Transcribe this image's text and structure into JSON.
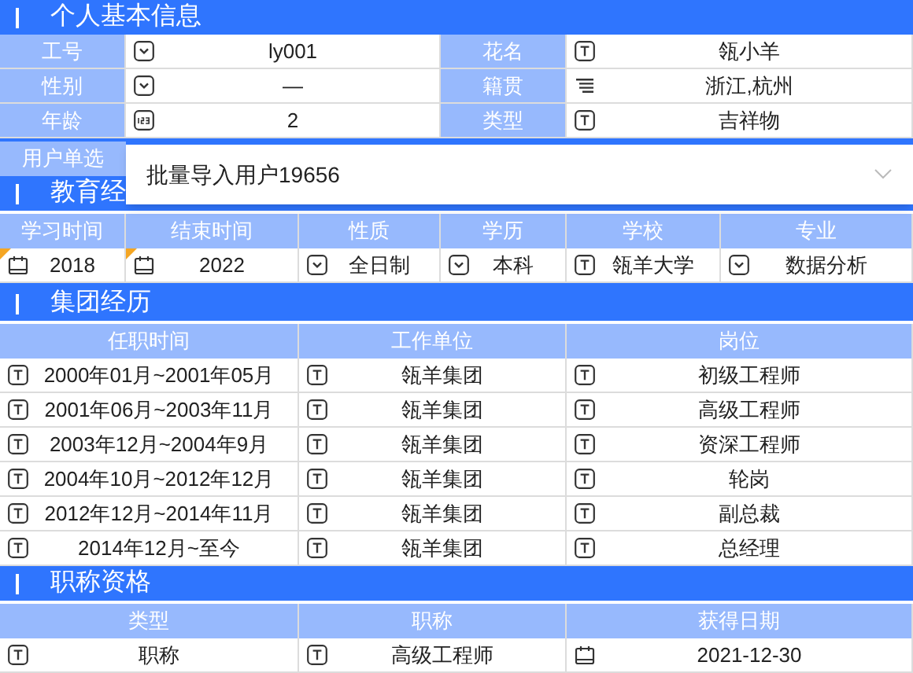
{
  "personal": {
    "title": "个人基本信息",
    "rows": [
      [
        {
          "label": "工号",
          "kind": "select",
          "value": "ly001"
        },
        {
          "label": "花名",
          "kind": "text",
          "value": "瓴小羊"
        }
      ],
      [
        {
          "label": "性别",
          "kind": "select",
          "value": "—"
        },
        {
          "label": "籍贯",
          "kind": "region",
          "value": "浙江,杭州"
        }
      ],
      [
        {
          "label": "年龄",
          "kind": "number",
          "value": "2"
        },
        {
          "label": "类型",
          "kind": "text",
          "value": "吉祥物"
        }
      ]
    ],
    "user_select": {
      "label": "用户单选",
      "option": "批量导入用户19656"
    }
  },
  "education": {
    "title": "教育经",
    "columns": [
      "学习时间",
      "结束时间",
      "性质",
      "学历",
      "学校",
      "专业"
    ],
    "rows": [
      [
        {
          "kind": "date",
          "value": "2018",
          "flagged": true
        },
        {
          "kind": "date",
          "value": "2022",
          "flagged": true
        },
        {
          "kind": "select",
          "value": "全日制",
          "flagged": false
        },
        {
          "kind": "select",
          "value": "本科",
          "flagged": false
        },
        {
          "kind": "text",
          "value": "瓴羊大学",
          "flagged": false
        },
        {
          "kind": "select",
          "value": "数据分析",
          "flagged": false
        }
      ]
    ]
  },
  "group": {
    "title": "集团经历",
    "columns": [
      "任职时间",
      "工作单位",
      "岗位"
    ],
    "rows": [
      [
        {
          "kind": "text",
          "value": "2000年01月~2001年05月"
        },
        {
          "kind": "text",
          "value": "瓴羊集团"
        },
        {
          "kind": "text",
          "value": "初级工程师"
        }
      ],
      [
        {
          "kind": "text",
          "value": "2001年06月~2003年11月"
        },
        {
          "kind": "text",
          "value": "瓴羊集团"
        },
        {
          "kind": "text",
          "value": "高级工程师"
        }
      ],
      [
        {
          "kind": "text",
          "value": "2003年12月~2004年9月"
        },
        {
          "kind": "text",
          "value": "瓴羊集团"
        },
        {
          "kind": "text",
          "value": "资深工程师"
        }
      ],
      [
        {
          "kind": "text",
          "value": "2004年10月~2012年12月"
        },
        {
          "kind": "text",
          "value": "瓴羊集团"
        },
        {
          "kind": "text",
          "value": "轮岗"
        }
      ],
      [
        {
          "kind": "text",
          "value": "2012年12月~2014年11月"
        },
        {
          "kind": "text",
          "value": "瓴羊集团"
        },
        {
          "kind": "text",
          "value": "副总裁"
        }
      ],
      [
        {
          "kind": "text",
          "value": "2014年12月~至今"
        },
        {
          "kind": "text",
          "value": "瓴羊集团"
        },
        {
          "kind": "text",
          "value": "总经理"
        }
      ]
    ]
  },
  "titles": {
    "title": "职称资格",
    "columns": [
      "类型",
      "职称",
      "获得日期"
    ],
    "rows": [
      [
        {
          "kind": "text",
          "value": "职称"
        },
        {
          "kind": "text",
          "value": "高级工程师"
        },
        {
          "kind": "date",
          "value": "2021-12-30"
        }
      ]
    ]
  }
}
